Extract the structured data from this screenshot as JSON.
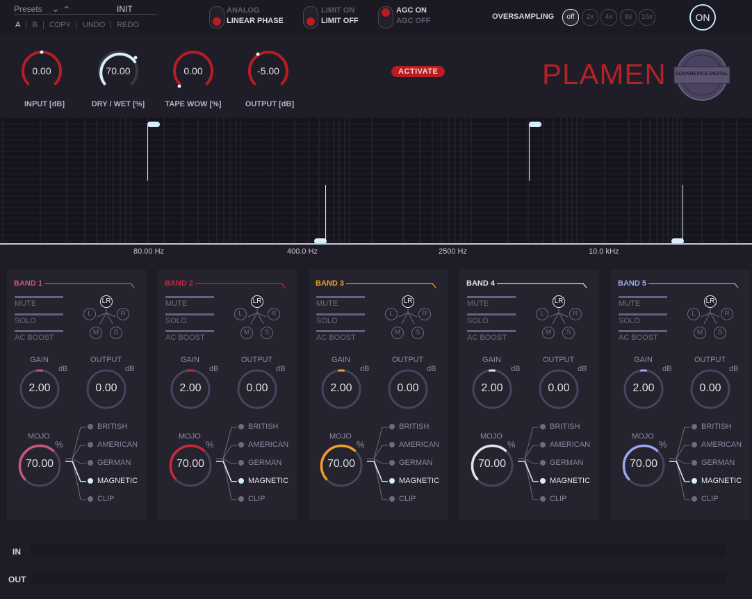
{
  "top": {
    "presets_label": "Presets",
    "preset_name": "INIT",
    "preset_buttons": [
      "A",
      "B",
      "COPY",
      "UNDO",
      "REDO"
    ],
    "phase": {
      "opt1": "ANALOG",
      "opt2": "LINEAR PHASE"
    },
    "limit": {
      "opt1": "LIMIT ON",
      "opt2": "LIMIT OFF"
    },
    "agc": {
      "opt1": "AGC ON",
      "opt2": "AGC OFF"
    },
    "oversampling_label": "OVERSAMPLING",
    "oversampling_options": [
      "off",
      "2x",
      "4x",
      "8x",
      "16x"
    ],
    "power_label": "ON"
  },
  "knobs": [
    {
      "label": "INPUT [dB]",
      "value": "0.00"
    },
    {
      "label": "DRY / WET [%]",
      "value": "70.00"
    },
    {
      "label": "TAPE WOW [%]",
      "value": "0.00"
    },
    {
      "label": "OUTPUT [dB]",
      "value": "-5.00"
    }
  ],
  "activate_label": "ACTIVATE",
  "brand": "PLAMEN",
  "logo_text": "SOUNDEVICE DIGITAL",
  "freq_labels": [
    "80.00 Hz",
    "400.0 Hz",
    "2500 Hz",
    "10.0 kHz"
  ],
  "band_controls": {
    "mute": "MUTE",
    "solo": "SOLO",
    "acboost": "AC BOOST",
    "lr": "LR",
    "l": "L",
    "r": "R",
    "m": "M",
    "s": "S",
    "gain": "GAIN",
    "output": "OUTPUT",
    "db": "dB",
    "mojo": "MOJO",
    "pct": "%"
  },
  "mojo_options": [
    "BRITISH",
    "AMERICAN",
    "GERMAN",
    "MAGNETIC",
    "CLIP"
  ],
  "bands": [
    {
      "name": "BAND 1",
      "color": "#c8587a",
      "gain": "2.00",
      "output": "0.00",
      "mojo": "70.00",
      "active_mojo": "MAGNETIC"
    },
    {
      "name": "BAND 2",
      "color": "#c8283a",
      "gain": "2.00",
      "output": "0.00",
      "mojo": "70.00",
      "active_mojo": "MAGNETIC"
    },
    {
      "name": "BAND 3",
      "color": "#f0a020",
      "gain": "2.00",
      "output": "0.00",
      "mojo": "70.00",
      "active_mojo": "MAGNETIC"
    },
    {
      "name": "BAND 4",
      "color": "#e4e2ee",
      "gain": "2.00",
      "output": "0.00",
      "mojo": "70.00",
      "active_mojo": "MAGNETIC"
    },
    {
      "name": "BAND 5",
      "color": "#9aa6ee",
      "gain": "2.00",
      "output": "0.00",
      "mojo": "70.00",
      "active_mojo": "MAGNETIC"
    }
  ],
  "meters": {
    "in": "IN",
    "out": "OUT"
  }
}
